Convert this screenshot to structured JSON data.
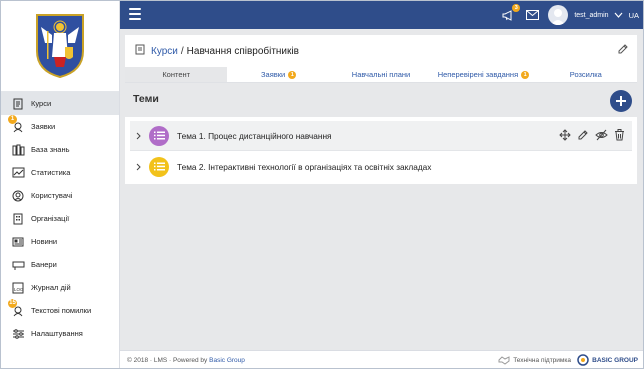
{
  "colors": {
    "topbar": "#2f4d8a",
    "accent": "#2f5aa8",
    "badge": "#f2a91d",
    "topic1": "#b06dc8",
    "topic2": "#f2c21b"
  },
  "sidebar": {
    "items": [
      {
        "label": "Курси",
        "icon": "course-icon",
        "active": true
      },
      {
        "label": "Заявки",
        "icon": "requests-icon",
        "badge": "1"
      },
      {
        "label": "База знань",
        "icon": "knowledge-base-icon"
      },
      {
        "label": "Статистика",
        "icon": "statistics-icon"
      },
      {
        "label": "Користувачі",
        "icon": "users-icon"
      },
      {
        "label": "Організації",
        "icon": "organizations-icon"
      },
      {
        "label": "Новини",
        "icon": "news-icon"
      },
      {
        "label": "Банери",
        "icon": "banners-icon"
      },
      {
        "label": "Журнал дій",
        "icon": "action-log-icon"
      },
      {
        "label": "Текстові помилки",
        "icon": "text-errors-icon",
        "badge": "15"
      },
      {
        "label": "Налаштування",
        "icon": "settings-icon"
      }
    ]
  },
  "topbar": {
    "notifications_badge": "3",
    "username": "test_admin",
    "language": "UA"
  },
  "breadcrumb": {
    "link": "Курси",
    "separator": "/",
    "current": "Навчання співробітників"
  },
  "tabs": [
    {
      "label": "Контент",
      "active": true
    },
    {
      "label": "Заявки",
      "badge": "1"
    },
    {
      "label": "Навчальні плани"
    },
    {
      "label": "Неперевірені завдання",
      "badge": "1"
    },
    {
      "label": "Розсилка"
    }
  ],
  "section": {
    "title": "Теми"
  },
  "topics": [
    {
      "title": "Тема 1. Процес дистанційного навчання"
    },
    {
      "title": "Тема 2. Інтерактивні технології в організаціях та освітніх закладах"
    }
  ],
  "footer": {
    "copyright": "© 2018 · LMS · Powered by",
    "powered_by": "Basic Group",
    "support": "Технічна підтримка",
    "brand": "BASIC GROUP"
  }
}
